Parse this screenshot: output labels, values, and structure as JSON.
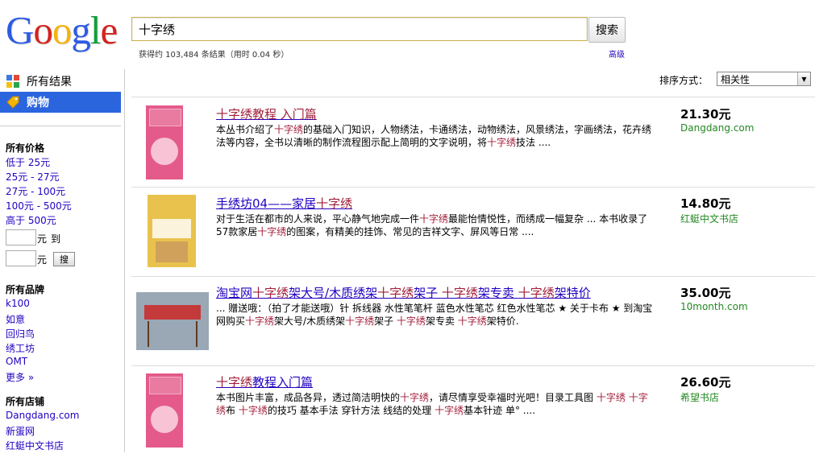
{
  "logo": {
    "letters": [
      "G",
      "o",
      "o",
      "g",
      "l",
      "e"
    ],
    "colors": [
      "#2d5be3",
      "#d5231f",
      "#f2b40d",
      "#2d5be3",
      "#109e3a",
      "#d5231f"
    ]
  },
  "search": {
    "query": "十字绣",
    "button": "搜索"
  },
  "stats": "获得约 103,484 条结果（用时 0.04 秒）",
  "advanced": "高级",
  "nav": {
    "all": "所有结果",
    "shopping": "购物"
  },
  "price_section": {
    "title": "所有价格",
    "links": [
      "低于 25元",
      "25元 - 27元",
      "27元 - 100元",
      "100元 - 500元",
      "高于 500元"
    ],
    "unit1": "元",
    "to": "到",
    "unit2": "元",
    "search_button": "搜"
  },
  "brand_section": {
    "title": "所有品牌",
    "links": [
      "k100",
      "如意",
      "回归鸟",
      "绣工坊",
      "OMT",
      "更多 »"
    ]
  },
  "store_section": {
    "title": "所有店铺",
    "links": [
      "Dangdang.com",
      "新蛋网",
      "红蜓中文书店"
    ]
  },
  "sort": {
    "label": "排序方式：",
    "value": "相关性"
  },
  "results": [
    {
      "title": "十字绣教程 入门篇",
      "desc": "本丛书介绍了十字绣的基础入门知识，人物绣法，卡通绣法，动物绣法，风景绣法，字画绣法，花卉绣法等内容，全书以清晰的制作流程图示配上简明的文字说明，将十字绣技法 ....",
      "price": "21.30元",
      "store": "Dangdang.com",
      "thumb_color": "#e45a8a"
    },
    {
      "title": "手绣坊04——家居十字绣",
      "desc": "对于生活在都市的人来说，平心静气地完成一件十字绣最能怡情悦性，而绣成一幅复杂 ... 本书收录了57款家居十字绣的图案，有精美的挂饰、常见的吉祥文字、屏风等日常 ....",
      "price": "14.80元",
      "store": "红蜓中文书店",
      "thumb_color": "#e9c24d"
    },
    {
      "title": "淘宝网十字绣架大号/木质绣架十字绣架子 十字绣架专卖 十字绣架特价",
      "desc": "... 赠送哦：（拍了才能送哦）针 拆线器 水性笔笔杆 蓝色水性笔芯 红色水性笔芯 ★ 关于卡布 ★ 到淘宝网购买十字绣架大号/木质绣架十字绣架子 十字绣架专卖 十字绣架特价.",
      "price": "35.00元",
      "store": "10month.com",
      "thumb_color": "#9aa7b5"
    },
    {
      "title": "十字绣教程入门篇",
      "desc": "本书图片丰富，成品各异，透过简洁明快的十字绣，请尽情享受幸福时光吧！目录工具图 十字绣 十字绣布 十字绣的技巧 基本手法 穿针方法 线结的处理 十字绣基本针迹 单° ....",
      "price": "26.60元",
      "store": "希望书店",
      "thumb_color": "#e45a8a"
    }
  ]
}
